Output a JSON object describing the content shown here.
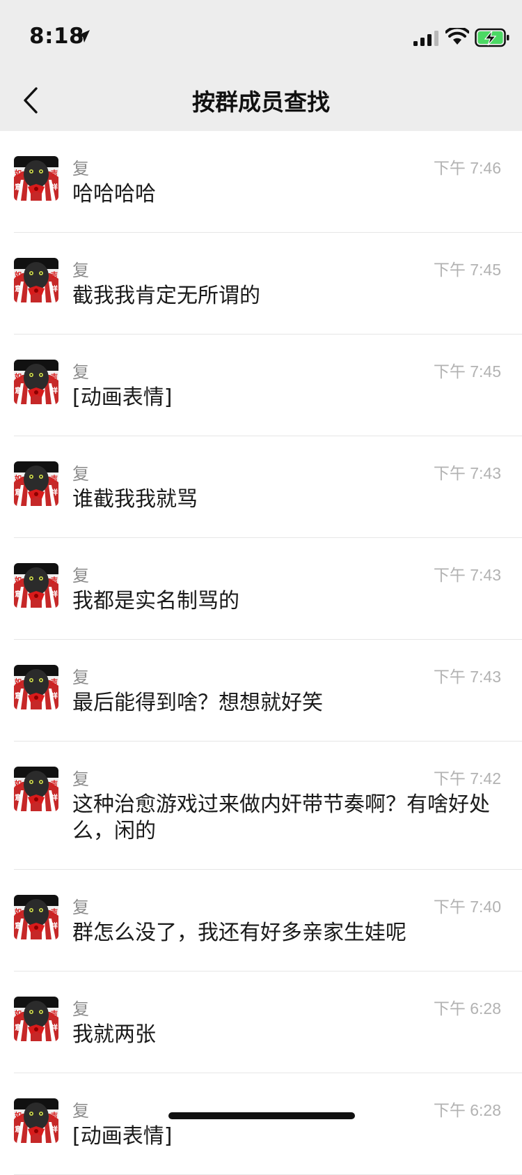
{
  "status_bar": {
    "time": "8:18"
  },
  "nav": {
    "title": "按群成员查找"
  },
  "messages": [
    {
      "sender": "复",
      "time": "下午 7:46",
      "text": "哈哈哈哈"
    },
    {
      "sender": "复",
      "time": "下午 7:45",
      "text": "截我我肯定无所谓的"
    },
    {
      "sender": "复",
      "time": "下午 7:45",
      "text": "[动画表情]"
    },
    {
      "sender": "复",
      "time": "下午 7:43",
      "text": "谁截我我就骂"
    },
    {
      "sender": "复",
      "time": "下午 7:43",
      "text": "我都是实名制骂的"
    },
    {
      "sender": "复",
      "time": "下午 7:43",
      "text": "最后能得到啥？想想就好笑"
    },
    {
      "sender": "复",
      "time": "下午 7:42",
      "text": "这种治愈游戏过来做内奸带节奏啊？有啥好处么，闲的"
    },
    {
      "sender": "复",
      "time": "下午 7:40",
      "text": "群怎么没了，我还有好多亲家生娃呢"
    },
    {
      "sender": "复",
      "time": "下午 6:28",
      "text": "我就两张"
    },
    {
      "sender": "复",
      "time": "下午 6:28",
      "text": "[动画表情]"
    }
  ],
  "avatar": {
    "corner_chars": [
      "如",
      "吉",
      "意",
      "祥"
    ]
  },
  "icons": {
    "back": "chevron-left-icon",
    "location": "location-arrow-icon",
    "signal": "cellular-signal-icon",
    "wifi": "wifi-icon",
    "battery": "battery-charging-icon"
  },
  "colors": {
    "nav_background": "#ededed",
    "timestamp": "#b2b2b2",
    "sender": "#8a8a8a",
    "battery_charge": "#4cd964"
  }
}
